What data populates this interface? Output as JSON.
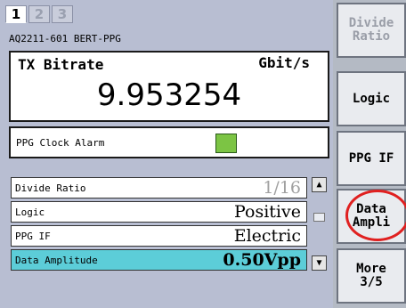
{
  "tabs": [
    {
      "label": "1",
      "active": true
    },
    {
      "label": "2",
      "active": false
    },
    {
      "label": "3",
      "active": false
    }
  ],
  "device_name": "AQ2211-601 BERT-PPG",
  "bitrate": {
    "label": "TX Bitrate",
    "unit": "Gbit/s",
    "value": "9.953254"
  },
  "alarm": {
    "label": "PPG Clock Alarm",
    "led_color": "#7cc444"
  },
  "params": [
    {
      "name": "Divide Ratio",
      "value": "1/16"
    },
    {
      "name": "Logic",
      "value": "Positive"
    },
    {
      "name": "PPG IF",
      "value": "Electric"
    },
    {
      "name": "Data Amplitude",
      "value": "0.50Vpp"
    }
  ],
  "softkeys": [
    {
      "label": "Divide\nRatio"
    },
    {
      "label": "Logic"
    },
    {
      "label": "PPG IF"
    },
    {
      "label": "Data\nAmpli"
    },
    {
      "label": "More\n3/5"
    }
  ],
  "colors": {
    "selected_row": "#5ccdd8",
    "highlight_ring": "#e02020"
  }
}
